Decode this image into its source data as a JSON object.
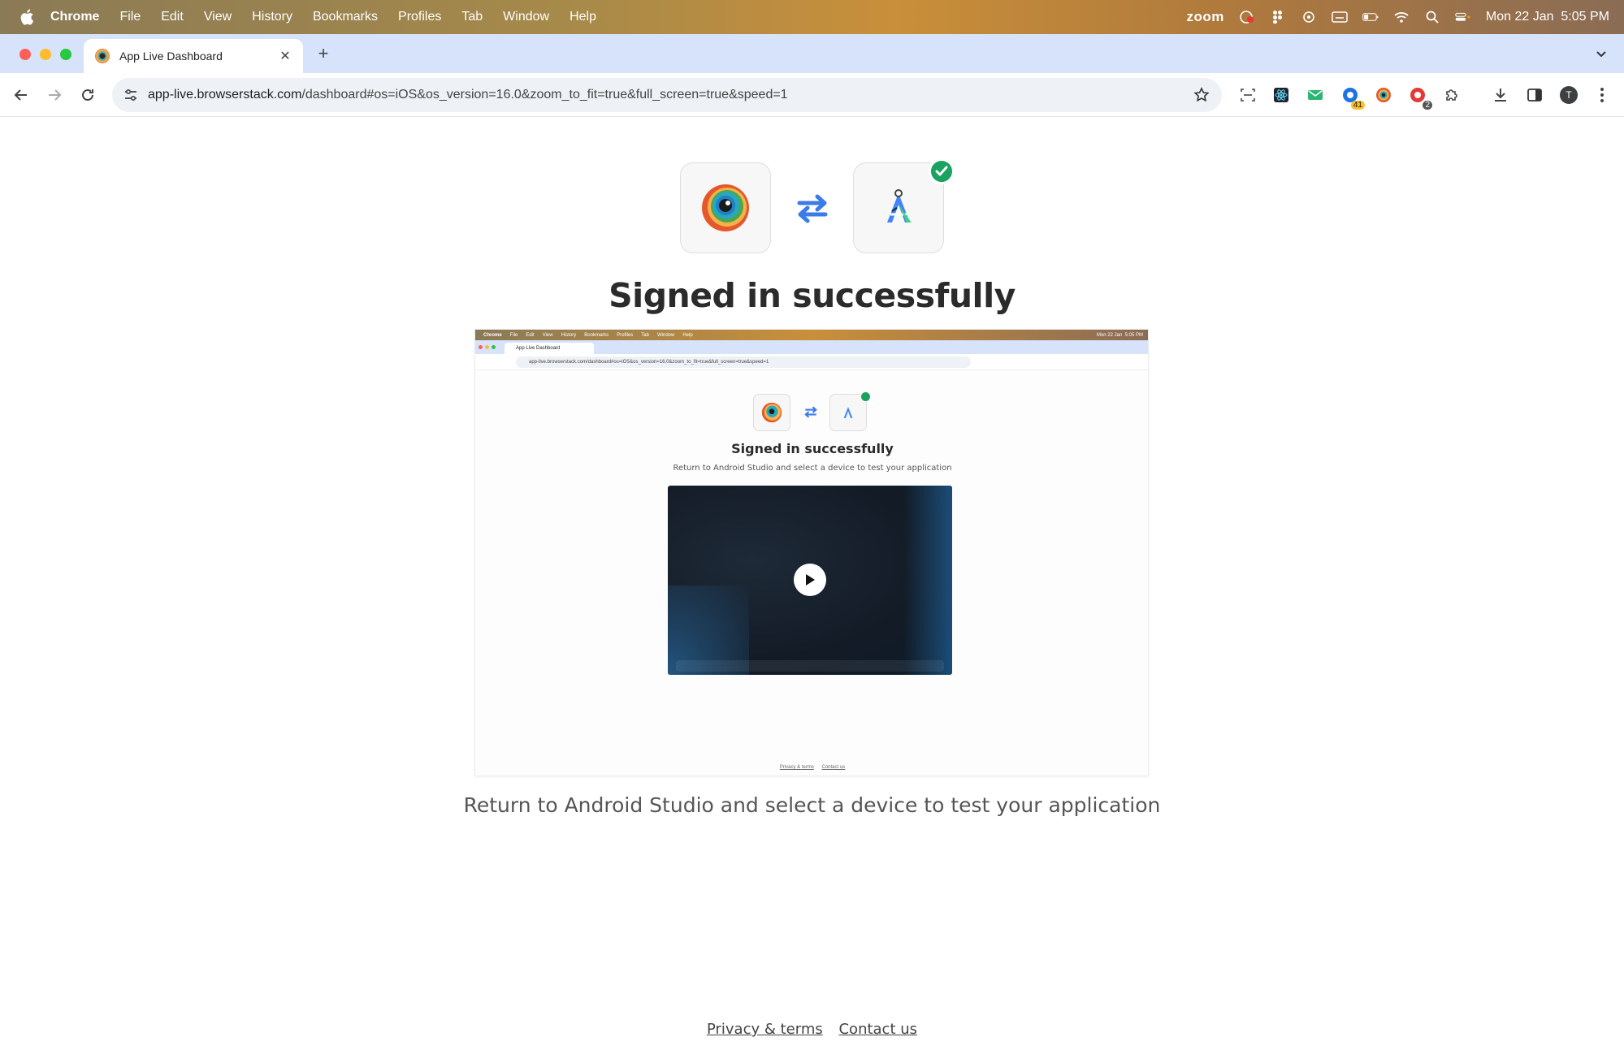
{
  "menubar": {
    "app_name": "Chrome",
    "items": [
      "File",
      "Edit",
      "View",
      "History",
      "Bookmarks",
      "Profiles",
      "Tab",
      "Window",
      "Help"
    ],
    "zoom_label": "zoom",
    "datetime": "Mon 22 Jan  5:05 PM"
  },
  "browser": {
    "tab_title": "App Live Dashboard",
    "url_domain": "app-live.browserstack.com",
    "url_path": "/dashboard#os=iOS&os_version=16.0&zoom_to_fit=true&full_screen=true&speed=1",
    "extension_badge_1": "41",
    "extension_badge_2": "2",
    "profile_initial": "T",
    "traffic_colors": [
      "#ff5f57",
      "#febc2e",
      "#28c840"
    ]
  },
  "page": {
    "title": "Signed in successfully",
    "subtitle": "Return to Android Studio and select a device to test your application",
    "footer": {
      "privacy": "Privacy & terms",
      "contact": "Contact us"
    }
  },
  "colors": {
    "accent_blue": "#3b7be8",
    "success_green": "#1aa260"
  }
}
